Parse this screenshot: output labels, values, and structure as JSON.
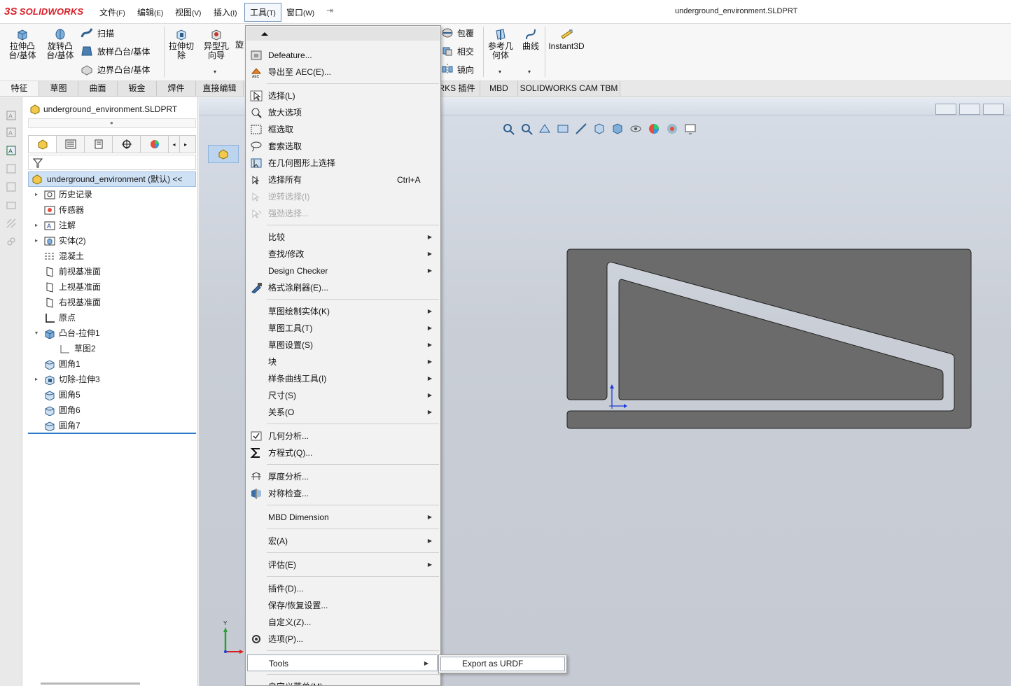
{
  "app": {
    "logo_text": "SOLIDWORKS",
    "logo_mark": "3S",
    "document_title": "underground_environment.SLDPRT"
  },
  "menubar": {
    "items": [
      {
        "label": "文件",
        "key": "(F)"
      },
      {
        "label": "编辑",
        "key": "(E)"
      },
      {
        "label": "视图",
        "key": "(V)"
      },
      {
        "label": "插入",
        "key": "(I)"
      },
      {
        "label": "工具",
        "key": "(T)"
      },
      {
        "label": "窗口",
        "key": "(W)"
      }
    ]
  },
  "command_manager": {
    "extrude_boss": "拉伸凸\n台/基体",
    "revolve_boss": "旋转凸\n台/基体",
    "sweep": "扫描",
    "loft": "放样凸台/基体",
    "boundary": "边界凸台/基体",
    "extrude_cut": "拉伸切\n除",
    "hole_wizard": "异型孔\n向导",
    "revolve_cut_partial": "旋",
    "wrap": "包覆",
    "intersect": "相交",
    "mirror": "镜向",
    "ref_geometry": "参考几\n何体",
    "curves": "曲线",
    "instant3d": "Instant3D"
  },
  "tabs": [
    "特征",
    "草图",
    "曲面",
    "钣金",
    "焊件",
    "直接编辑",
    "RKS 插件",
    "MBD",
    "SOLIDWORKS CAM TBM"
  ],
  "feature_manager": {
    "title": "underground_environment.SLDPRT",
    "root": "underground_environment  (默认) <<",
    "tree": [
      {
        "label": "历史记录",
        "icon": "history-icon",
        "expand": true
      },
      {
        "label": "传感器",
        "icon": "sensor-icon",
        "expand": false
      },
      {
        "label": "注解",
        "icon": "annotation-icon",
        "expand": true
      },
      {
        "label": "实体(2)",
        "icon": "solid-bodies-icon",
        "expand": true
      },
      {
        "label": "混凝土",
        "icon": "material-icon",
        "expand": false
      },
      {
        "label": "前视基准面",
        "icon": "plane-icon",
        "expand": false
      },
      {
        "label": "上视基准面",
        "icon": "plane-icon",
        "expand": false
      },
      {
        "label": "右视基准面",
        "icon": "plane-icon",
        "expand": false
      },
      {
        "label": "原点",
        "icon": "origin-icon",
        "expand": false
      },
      {
        "label": "凸台-拉伸1",
        "icon": "extrude-icon",
        "expand": true,
        "open": true
      },
      {
        "label": "草图2",
        "icon": "sketch-icon",
        "expand": false,
        "child": true
      },
      {
        "label": "圆角1",
        "icon": "fillet-icon",
        "expand": false
      },
      {
        "label": "切除-拉伸3",
        "icon": "cut-icon",
        "expand": true
      },
      {
        "label": "圆角5",
        "icon": "fillet-icon",
        "expand": false
      },
      {
        "label": "圆角6",
        "icon": "fillet-icon",
        "expand": false
      },
      {
        "label": "圆角7",
        "icon": "fillet-icon",
        "expand": false
      }
    ]
  },
  "tools_menu": {
    "items": [
      {
        "label": "Defeature...",
        "icon": "defeature-icon"
      },
      {
        "label": "导出至 AEC(E)...",
        "icon": "aec-icon"
      },
      {
        "sep": true
      },
      {
        "label": "选择(L)",
        "icon": "select-icon"
      },
      {
        "label": "放大选项",
        "icon": "magnify-select-icon"
      },
      {
        "label": "框选取",
        "icon": "box-select-icon"
      },
      {
        "label": "套索选取",
        "icon": "lasso-icon"
      },
      {
        "label": "在几何图形上选择",
        "icon": "select-geometry-icon"
      },
      {
        "label": "选择所有",
        "icon": "select-all-icon",
        "shortcut": "Ctrl+A"
      },
      {
        "label": "逆转选择(I)",
        "icon": "invert-select-icon",
        "disabled": true
      },
      {
        "label": "强劲选择...",
        "icon": "power-select-icon",
        "disabled": true
      },
      {
        "sep": true
      },
      {
        "label": "比较",
        "submenu": true
      },
      {
        "label": "查找/修改",
        "submenu": true
      },
      {
        "label": "Design Checker",
        "submenu": true
      },
      {
        "label": "格式涂刷器(E)...",
        "icon": "format-painter-icon"
      },
      {
        "sep": true
      },
      {
        "label": "草图绘制实体(K)",
        "submenu": true
      },
      {
        "label": "草图工具(T)",
        "submenu": true
      },
      {
        "label": "草图设置(S)",
        "submenu": true
      },
      {
        "label": "块",
        "submenu": true
      },
      {
        "label": "样条曲线工具(I)",
        "submenu": true
      },
      {
        "label": "尺寸(S)",
        "submenu": true
      },
      {
        "label": "关系(O",
        "submenu": true
      },
      {
        "sep": true
      },
      {
        "label": "几何分析...",
        "icon": "geometry-analysis-icon"
      },
      {
        "label": "方程式(Q)...",
        "icon": "sigma-icon"
      },
      {
        "sep": true
      },
      {
        "label": "厚度分析...",
        "icon": "thickness-icon"
      },
      {
        "label": "对称检查...",
        "icon": "symmetry-icon"
      },
      {
        "sep": true
      },
      {
        "label": "MBD Dimension",
        "submenu": true
      },
      {
        "sep": true
      },
      {
        "label": "宏(A)",
        "submenu": true
      },
      {
        "sep": true
      },
      {
        "label": "评估(E)",
        "submenu": true
      },
      {
        "sep": true
      },
      {
        "label": "插件(D)..."
      },
      {
        "label": "保存/恢复设置..."
      },
      {
        "label": "自定义(Z)..."
      },
      {
        "label": "选项(P)...",
        "icon": "gear-icon"
      },
      {
        "sep": true
      },
      {
        "label": "Tools",
        "submenu": true,
        "highlight": true
      },
      {
        "sep": true
      },
      {
        "label": "自定义菜单(M)"
      }
    ]
  },
  "tools_submenu": {
    "items": [
      "Export as URDF"
    ]
  },
  "triad": {
    "y_label": "Y"
  },
  "colors": {
    "accent": "#2a7cc7",
    "brand_red": "#d8202a",
    "part_fill": "#6b6b6b",
    "part_slot": "#c5cad3"
  }
}
